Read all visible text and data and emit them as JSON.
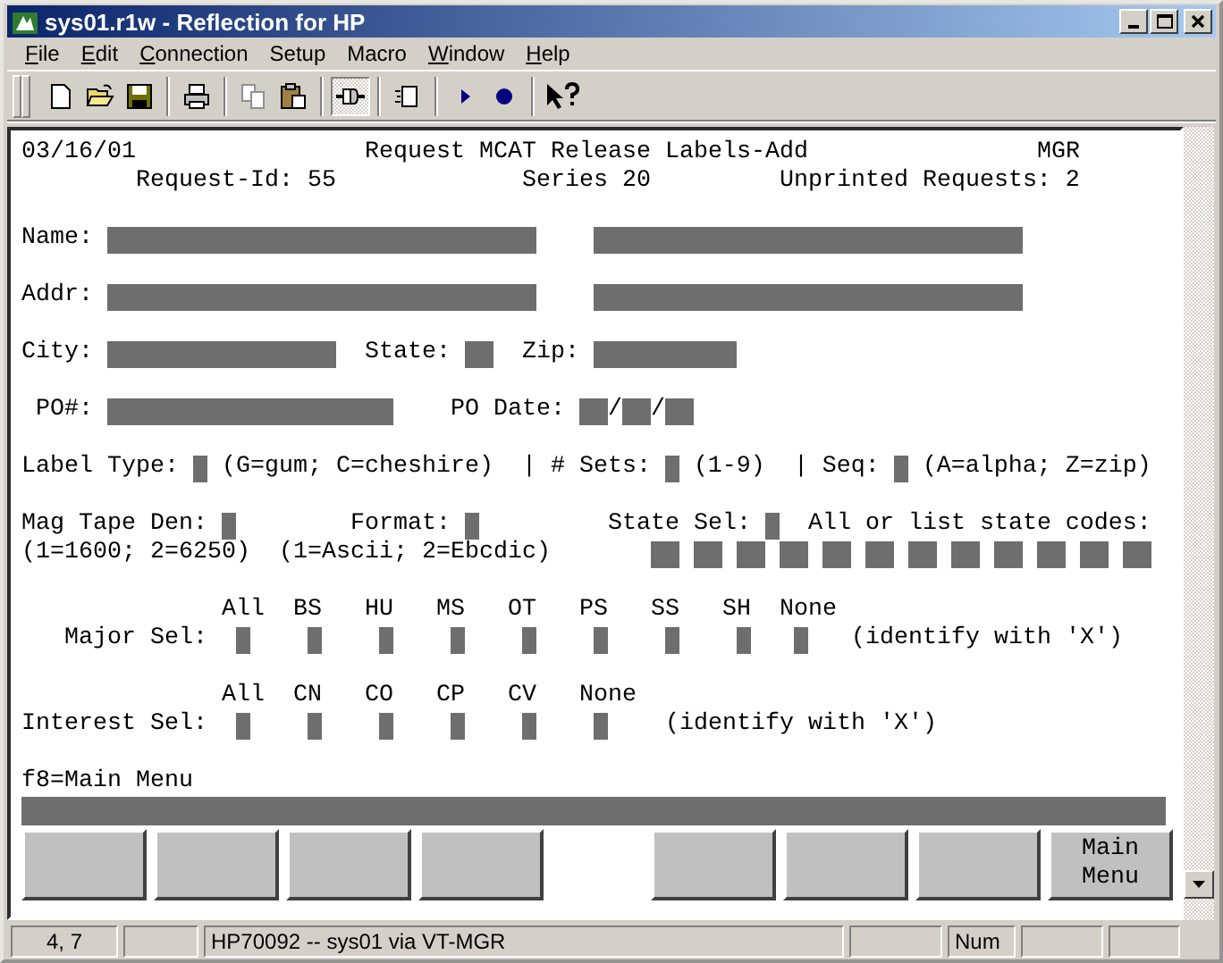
{
  "window": {
    "title": "sys01.r1w - Reflection for HP"
  },
  "menu": [
    {
      "label": "File",
      "first_letter_underlined": true
    },
    {
      "label": "Edit",
      "first_letter_underlined": true
    },
    {
      "label": "Connection",
      "first_letter_underlined": true
    },
    {
      "label": "Setup",
      "first_letter_underlined": false
    },
    {
      "label": "Macro",
      "first_letter_underlined": false
    },
    {
      "label": "Window",
      "first_letter_underlined": true
    },
    {
      "label": "Help",
      "first_letter_underlined": true
    }
  ],
  "toolbar": {
    "connected": true
  },
  "terminal": {
    "lines": [
      {
        "segments": [
          {
            "kind": "text",
            "text": "03/16/01"
          },
          {
            "kind": "text",
            "text": "Request MCAT Release Labels-Add"
          },
          {
            "kind": "text",
            "text": "MGR"
          }
        ]
      },
      {
        "segments": [
          {
            "kind": "text",
            "text": "Request-Id: 55"
          },
          {
            "kind": "text",
            "text": "Series 20"
          },
          {
            "kind": "text",
            "text": "Unprinted Requests: 2"
          }
        ]
      },
      {
        "segments": [
          {
            "kind": "text",
            "text": "Name:"
          },
          {
            "kind": "field"
          },
          {
            "kind": "field"
          }
        ]
      },
      {
        "segments": [
          {
            "kind": "text",
            "text": "Addr:"
          },
          {
            "kind": "field"
          },
          {
            "kind": "field"
          }
        ]
      },
      {
        "segments": [
          {
            "kind": "text",
            "text": "City:"
          },
          {
            "kind": "field"
          },
          {
            "kind": "text",
            "text": "State:"
          },
          {
            "kind": "field"
          },
          {
            "kind": "text",
            "text": "Zip:"
          },
          {
            "kind": "field"
          }
        ]
      },
      {
        "segments": [
          {
            "kind": "text",
            "text": "PO#:"
          },
          {
            "kind": "field"
          },
          {
            "kind": "text",
            "text": "PO Date:"
          },
          {
            "kind": "field"
          },
          {
            "kind": "text",
            "text": "/"
          },
          {
            "kind": "field"
          },
          {
            "kind": "text",
            "text": "/"
          },
          {
            "kind": "field"
          }
        ]
      },
      {
        "segments": [
          {
            "kind": "text",
            "text": "Label Type:"
          },
          {
            "kind": "field"
          },
          {
            "kind": "text",
            "text": "(G=gum; C=cheshire)"
          },
          {
            "kind": "text",
            "text": "| # Sets:"
          },
          {
            "kind": "field"
          },
          {
            "kind": "text",
            "text": "(1-9)"
          },
          {
            "kind": "text",
            "text": "| Seq:"
          },
          {
            "kind": "field"
          },
          {
            "kind": "text",
            "text": "(A=alpha; Z=zip)"
          }
        ]
      },
      {
        "segments": [
          {
            "kind": "text",
            "text": "Mag Tape Den:"
          },
          {
            "kind": "field"
          },
          {
            "kind": "text",
            "text": "Format:"
          },
          {
            "kind": "field"
          },
          {
            "kind": "text",
            "text": "State Sel:"
          },
          {
            "kind": "field"
          },
          {
            "kind": "text",
            "text": "All or list state codes:"
          }
        ]
      },
      {
        "segments": [
          {
            "kind": "text",
            "text": "(1=1600; 2=6250)"
          },
          {
            "kind": "text",
            "text": "(1=Ascii; 2=Ebcdic)"
          },
          {
            "kind": "field"
          },
          {
            "kind": "field"
          },
          {
            "kind": "field"
          },
          {
            "kind": "field"
          },
          {
            "kind": "field"
          },
          {
            "kind": "field"
          },
          {
            "kind": "field"
          },
          {
            "kind": "field"
          },
          {
            "kind": "field"
          },
          {
            "kind": "field"
          },
          {
            "kind": "field"
          },
          {
            "kind": "field"
          }
        ]
      },
      {
        "segments": [
          {
            "kind": "text",
            "text": "All"
          },
          {
            "kind": "text",
            "text": "BS"
          },
          {
            "kind": "text",
            "text": "HU"
          },
          {
            "kind": "text",
            "text": "MS"
          },
          {
            "kind": "text",
            "text": "OT"
          },
          {
            "kind": "text",
            "text": "PS"
          },
          {
            "kind": "text",
            "text": "SS"
          },
          {
            "kind": "text",
            "text": "SH"
          },
          {
            "kind": "text",
            "text": "None"
          }
        ]
      },
      {
        "segments": [
          {
            "kind": "text",
            "text": "Major Sel:"
          },
          {
            "kind": "field"
          },
          {
            "kind": "field"
          },
          {
            "kind": "field"
          },
          {
            "kind": "field"
          },
          {
            "kind": "field"
          },
          {
            "kind": "field"
          },
          {
            "kind": "field"
          },
          {
            "kind": "field"
          },
          {
            "kind": "field"
          },
          {
            "kind": "text",
            "text": "(identify with 'X')"
          }
        ]
      },
      {
        "segments": [
          {
            "kind": "text",
            "text": "All"
          },
          {
            "kind": "text",
            "text": "CN"
          },
          {
            "kind": "text",
            "text": "CO"
          },
          {
            "kind": "text",
            "text": "CP"
          },
          {
            "kind": "text",
            "text": "CV"
          },
          {
            "kind": "text",
            "text": "None"
          }
        ]
      },
      {
        "segments": [
          {
            "kind": "text",
            "text": "Interest Sel:"
          },
          {
            "kind": "field"
          },
          {
            "kind": "field"
          },
          {
            "kind": "field"
          },
          {
            "kind": "field"
          },
          {
            "kind": "field"
          },
          {
            "kind": "field"
          },
          {
            "kind": "text",
            "text": "(identify with 'X')"
          }
        ]
      },
      {
        "segments": [
          {
            "kind": "text",
            "text": "f8=Main Menu"
          }
        ]
      }
    ]
  },
  "function_keys": [
    {
      "kind": "blank"
    },
    {
      "kind": "blank"
    },
    {
      "kind": "blank"
    },
    {
      "kind": "blank"
    },
    {
      "kind": "blank"
    },
    {
      "kind": "blank"
    },
    {
      "kind": "blank"
    },
    {
      "kind": "labeled",
      "label": "Main Menu"
    }
  ],
  "status_bar": [
    {
      "kind": "text",
      "text": "4, 7"
    },
    {
      "kind": "empty"
    },
    {
      "kind": "text",
      "text": "HP70092 -- sys01 via VT-MGR"
    },
    {
      "kind": "empty"
    },
    {
      "kind": "text",
      "text": "Num"
    },
    {
      "kind": "empty"
    },
    {
      "kind": "empty"
    }
  ]
}
